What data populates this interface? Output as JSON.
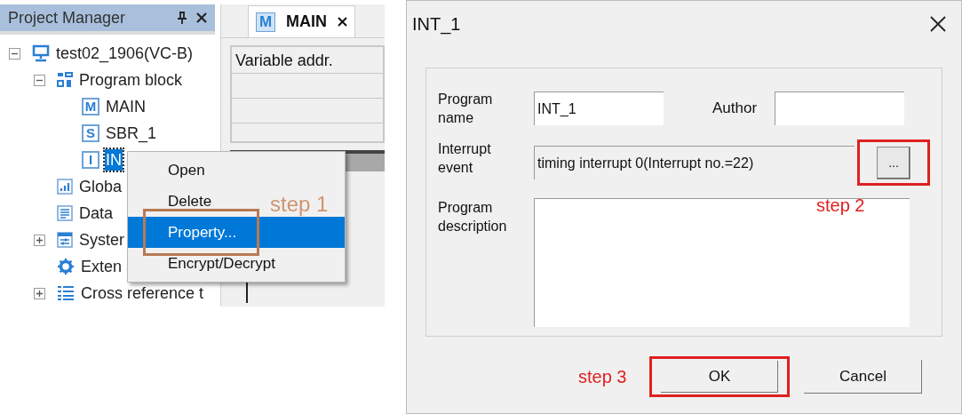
{
  "project_manager": {
    "title": "Project Manager",
    "tree": [
      {
        "label": "test02_1906(VC-B)",
        "kind": "computer",
        "expanded": true,
        "selected": false,
        "children": [
          {
            "label": "Program block",
            "kind": "blocks",
            "expanded": true,
            "selected": false,
            "children": [
              {
                "label": "MAIN",
                "kind": "letter",
                "badge": "M",
                "selected": false
              },
              {
                "label": "SBR_1",
                "kind": "letter",
                "badge": "S",
                "selected": false
              },
              {
                "label": "IN",
                "kind": "letter",
                "badge": "I",
                "selected": true
              }
            ]
          },
          {
            "label": "Globa",
            "kind": "chart",
            "selected": false
          },
          {
            "label": "Data",
            "kind": "document",
            "selected": false
          },
          {
            "label": "Syster",
            "kind": "sliders",
            "expanded": false,
            "selected": false
          },
          {
            "label": "Exten",
            "kind": "gear",
            "selected": false
          },
          {
            "label": "Cross reference t",
            "kind": "list",
            "expanded": false,
            "selected": false
          }
        ]
      }
    ]
  },
  "editor": {
    "tab": {
      "label": "MAIN",
      "badge": "M",
      "selected": true
    },
    "table": {
      "columns": [
        "Variable addr."
      ]
    }
  },
  "context_menu": {
    "items": [
      {
        "label": "Open",
        "selected": false
      },
      {
        "label": "Delete",
        "selected": false
      },
      {
        "label": "Property...",
        "selected": true
      },
      {
        "label": "Encrypt/Decrypt",
        "selected": false
      }
    ],
    "annotation": "step 1"
  },
  "dialog": {
    "title": "INT_1",
    "program_name": {
      "label": "Program name",
      "value": "INT_1"
    },
    "author": {
      "label": "Author"
    },
    "interrupt_event": {
      "label": "Interrupt event",
      "value": "timing interrupt 0(Interrupt no.=22)",
      "button": "...",
      "annotation": "step 2"
    },
    "program_description": {
      "label": "Program description"
    },
    "buttons": [
      {
        "label": "OK",
        "annotation": "step 3"
      },
      {
        "label": "Cancel"
      }
    ]
  }
}
